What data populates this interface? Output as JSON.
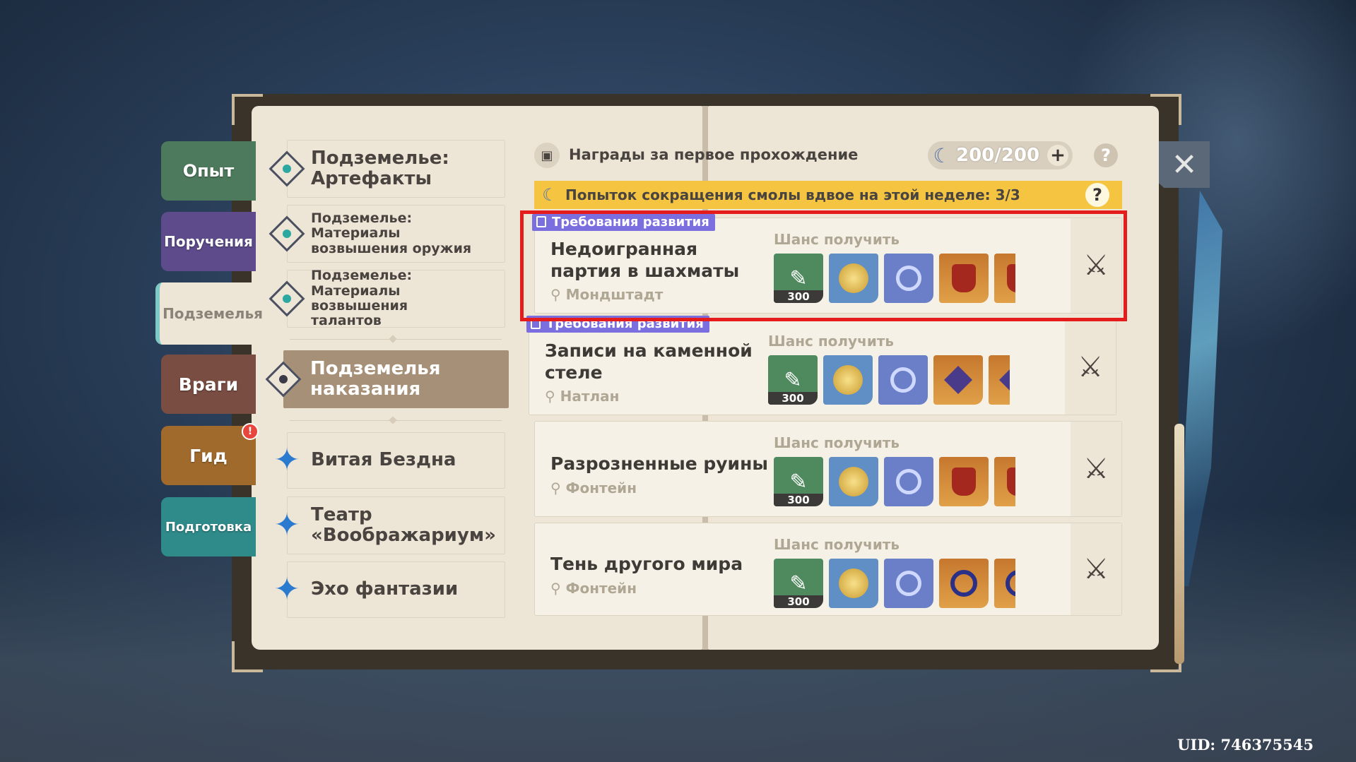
{
  "uid": "UID: 746375545",
  "tabs": {
    "exp": "Опыт",
    "quests": "Поручения",
    "domains": "Подземелья",
    "enemies": "Враги",
    "guide": "Гид",
    "guide_badge": "!",
    "prep": "Подготовка"
  },
  "menu": {
    "artifacts": "Подземелье: Артефакты",
    "weapon_mats": "Подземелье: Материалы возвышения оружия",
    "talent_mats": "Подземелье: Материалы возвышения талантов",
    "trounce": "Подземелья наказания",
    "abyss": "Витая Бездна",
    "theater": "Театр «Воображариум»",
    "echo": "Эхо фантазии"
  },
  "header": {
    "title": "Награды за первое прохождение",
    "resin": "200/200",
    "plus": "+",
    "help": "?"
  },
  "banner": {
    "text": "Попыток сокращения смолы вдвое на этой неделе: 3/3",
    "help": "?"
  },
  "domains": [
    {
      "req": "Требования развития",
      "name": "Недоигранная партия в шахматы",
      "location": "Мондштадт",
      "chance": "Шанс получить",
      "exp_qty": "300"
    },
    {
      "req": "Требования развития",
      "name": "Записи на каменной стеле",
      "location": "Натлан",
      "chance": "Шанс получить",
      "exp_qty": "300"
    },
    {
      "req": "",
      "name": "Разрозненные руины",
      "location": "Фонтейн",
      "chance": "Шанс получить",
      "exp_qty": "300"
    },
    {
      "req": "",
      "name": "Тень другого мира",
      "location": "Фонтейн",
      "chance": "Шанс получить",
      "exp_qty": "300"
    }
  ],
  "icons": {
    "close": "close-icon",
    "battle": "crossed-swords-icon",
    "location": "location-pin-icon",
    "resin": "moon-resin-icon"
  },
  "colors": {
    "banner": "#f5c542",
    "highlight": "#e41c1c",
    "requirement_tag": "#7b6fe0"
  }
}
